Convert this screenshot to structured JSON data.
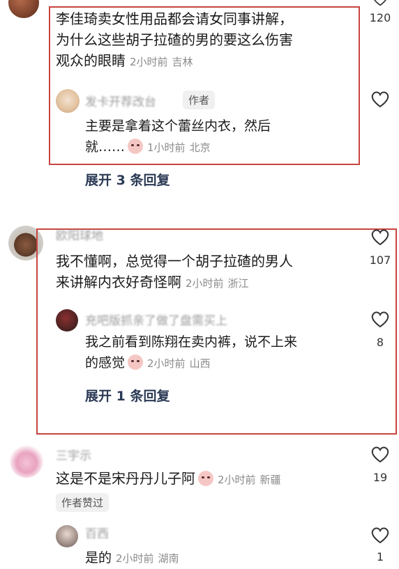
{
  "comments": [
    {
      "text_lines": [
        "李佳琦卖女性用品都会请女同事讲解，",
        "为什么这些胡子拉碴的男的要这么伤害",
        "观众的眼睛"
      ],
      "time": "2小时前",
      "location": "吉林",
      "likes": "120",
      "reply": {
        "author_blurred": "发卡开荐改台",
        "author_tag": "作者",
        "text_lines": [
          "主要是拿着这个蕾丝内衣，然后",
          "就……"
        ],
        "time": "1小时前",
        "location": "北京"
      },
      "expand_label": "展开 3 条回复"
    },
    {
      "author_blurred": "欧阳球地",
      "text_lines": [
        "我不懂啊，总觉得一个胡子拉碴的男人",
        "来讲解内衣好奇怪啊"
      ],
      "time": "2小时前",
      "location": "浙江",
      "likes": "107",
      "reply": {
        "author_blurred": "充吧版抓亲了做了盘需买上",
        "text_lines": [
          "我之前看到陈翔在卖内裤，说不上来",
          "的感觉"
        ],
        "time": "2小时前",
        "location": "山西",
        "likes": "8"
      },
      "expand_label": "展开 1 条回复"
    },
    {
      "author_blurred": "三宇示",
      "text_lines": [
        "这是不是宋丹丹儿子阿"
      ],
      "time": "2小时前",
      "location": "新疆",
      "likes": "19",
      "author_liked_tag": "作者赞过",
      "reply": {
        "author_blurred": "百西",
        "text_lines": [
          "是的"
        ],
        "time": "2小时前",
        "location": "湖南",
        "likes": "1"
      }
    }
  ],
  "colors": {
    "highlight_box": "#c7443f",
    "expand_text": "#2b3a55",
    "meta_text": "#8a8a8a"
  }
}
